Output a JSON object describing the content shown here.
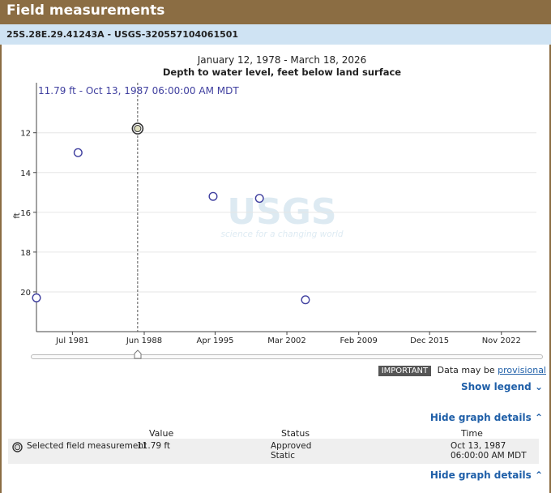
{
  "page_title": "Field measurements",
  "site_label": "25S.28E.29.41243A - USGS-320557104061501",
  "chart_data": {
    "type": "scatter",
    "date_range": "January 12, 1978 - March 18, 2026",
    "title": "Depth to water level, feet below land surface",
    "ylabel": "ft",
    "y_inverted": true,
    "ylim": [
      10.3,
      22.0
    ],
    "yticks": [
      "12",
      "14",
      "16",
      "18",
      "20"
    ],
    "xlim": [
      "1978-01-12",
      "2026-03-18"
    ],
    "xticks": [
      {
        "label": "Jul 1981",
        "date": "1981-07-01"
      },
      {
        "label": "Jun 1988",
        "date": "1988-06-01"
      },
      {
        "label": "Apr 1995",
        "date": "1995-04-01"
      },
      {
        "label": "Mar 2002",
        "date": "2002-03-01"
      },
      {
        "label": "Feb 2009",
        "date": "2009-02-01"
      },
      {
        "label": "Dec 2015",
        "date": "2015-12-01"
      },
      {
        "label": "Nov 2022",
        "date": "2022-11-01"
      }
    ],
    "points": [
      {
        "x": "1978-01-12",
        "y": 20.3
      },
      {
        "x": "1982-01-15",
        "y": 13.0
      },
      {
        "x": "1987-10-13",
        "y": 11.79,
        "selected": true
      },
      {
        "x": "1995-01-20",
        "y": 15.2
      },
      {
        "x": "1999-07-10",
        "y": 15.3
      },
      {
        "x": "2003-12-15",
        "y": 20.4
      }
    ],
    "grid": true,
    "marker_color": "#3f3f9f",
    "tooltip": "11.79 ft - Oct 13, 1987 06:00:00 AM MDT",
    "watermark_logo": "USGS",
    "watermark_tagline": "science for a changing world"
  },
  "provisional": {
    "badge": "IMPORTANT",
    "text": "Data may be",
    "link": "provisional"
  },
  "show_legend": "Show legend",
  "hide_graph_details": "Hide graph details",
  "table": {
    "headers": [
      "Value",
      "Status",
      "Time"
    ],
    "row": {
      "label": "Selected field measurement",
      "value": "11.79 ft",
      "status_line1": "Approved",
      "status_line2": "Static",
      "time_line1": "Oct 13, 1987",
      "time_line2": "06:00:00 AM MDT"
    }
  },
  "colors": {
    "header_brown": "#8b6d43",
    "site_bar_blue": "#cfe3f3",
    "link_blue": "#1f5fa8"
  }
}
